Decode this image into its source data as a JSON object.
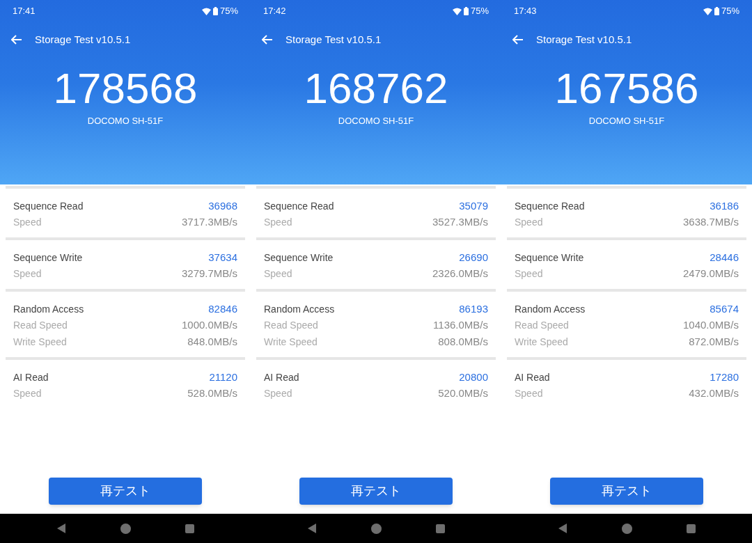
{
  "screens": [
    {
      "status_bar": {
        "time": "17:41",
        "battery": "75%"
      },
      "app_bar": {
        "title": "Storage Test v10.5.1"
      },
      "total_score": "178568",
      "device": "DOCOMO SH-51F",
      "sections": [
        {
          "title": "Sequence Read",
          "score": "36968",
          "metrics": [
            {
              "label": "Speed",
              "value": "3717.3MB/s"
            }
          ]
        },
        {
          "title": "Sequence Write",
          "score": "37634",
          "metrics": [
            {
              "label": "Speed",
              "value": "3279.7MB/s"
            }
          ]
        },
        {
          "title": "Random Access",
          "score": "82846",
          "metrics": [
            {
              "label": "Read Speed",
              "value": "1000.0MB/s"
            },
            {
              "label": "Write Speed",
              "value": "848.0MB/s"
            }
          ]
        },
        {
          "title": "AI Read",
          "score": "21120",
          "metrics": [
            {
              "label": "Speed",
              "value": "528.0MB/s"
            }
          ]
        }
      ],
      "button": "再テスト"
    },
    {
      "status_bar": {
        "time": "17:42",
        "battery": "75%"
      },
      "app_bar": {
        "title": "Storage Test v10.5.1"
      },
      "total_score": "168762",
      "device": "DOCOMO SH-51F",
      "sections": [
        {
          "title": "Sequence Read",
          "score": "35079",
          "metrics": [
            {
              "label": "Speed",
              "value": "3527.3MB/s"
            }
          ]
        },
        {
          "title": "Sequence Write",
          "score": "26690",
          "metrics": [
            {
              "label": "Speed",
              "value": "2326.0MB/s"
            }
          ]
        },
        {
          "title": "Random Access",
          "score": "86193",
          "metrics": [
            {
              "label": "Read Speed",
              "value": "1136.0MB/s"
            },
            {
              "label": "Write Speed",
              "value": "808.0MB/s"
            }
          ]
        },
        {
          "title": "AI Read",
          "score": "20800",
          "metrics": [
            {
              "label": "Speed",
              "value": "520.0MB/s"
            }
          ]
        }
      ],
      "button": "再テスト"
    },
    {
      "status_bar": {
        "time": "17:43",
        "battery": "75%"
      },
      "app_bar": {
        "title": "Storage Test v10.5.1"
      },
      "total_score": "167586",
      "device": "DOCOMO SH-51F",
      "sections": [
        {
          "title": "Sequence Read",
          "score": "36186",
          "metrics": [
            {
              "label": "Speed",
              "value": "3638.7MB/s"
            }
          ]
        },
        {
          "title": "Sequence Write",
          "score": "28446",
          "metrics": [
            {
              "label": "Speed",
              "value": "2479.0MB/s"
            }
          ]
        },
        {
          "title": "Random Access",
          "score": "85674",
          "metrics": [
            {
              "label": "Read Speed",
              "value": "1040.0MB/s"
            },
            {
              "label": "Write Speed",
              "value": "872.0MB/s"
            }
          ]
        },
        {
          "title": "AI Read",
          "score": "17280",
          "metrics": [
            {
              "label": "Speed",
              "value": "432.0MB/s"
            }
          ]
        }
      ],
      "button": "再テスト"
    }
  ]
}
